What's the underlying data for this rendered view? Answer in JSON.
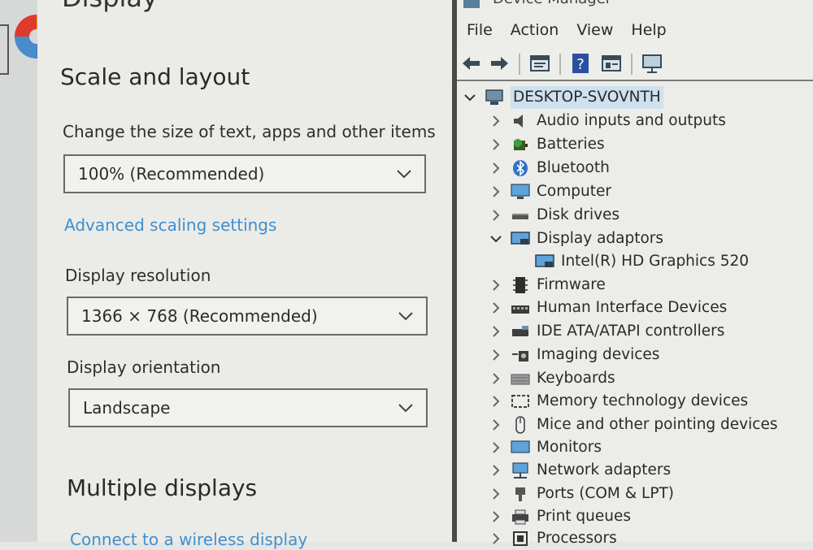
{
  "settings": {
    "page_title": "Display",
    "section_heading": "Scale and layout",
    "scale_label": "Change the size of text, apps and other items",
    "scale_value": "100% (Recommended)",
    "advanced_link": "Advanced scaling settings",
    "resolution_label": "Display resolution",
    "resolution_value": "1366 × 768 (Recommended)",
    "orientation_label": "Display orientation",
    "orientation_value": "Landscape",
    "multiple_heading": "Multiple displays",
    "wireless_link": "Connect to a wireless display"
  },
  "device_manager": {
    "title": "Device Manager",
    "menu": [
      "File",
      "Action",
      "View",
      "Help"
    ],
    "toolbar_icons": [
      "back-arrow-icon",
      "forward-arrow-icon",
      "properties-icon",
      "help-icon",
      "view-resources-icon",
      "monitor-scan-icon"
    ],
    "root": "DESKTOP-SVOVNTH",
    "categories": [
      {
        "label": "Audio inputs and outputs",
        "icon": "speaker-icon",
        "expanded": false
      },
      {
        "label": "Batteries",
        "icon": "battery-icon",
        "expanded": false
      },
      {
        "label": "Bluetooth",
        "icon": "bluetooth-icon",
        "expanded": false
      },
      {
        "label": "Computer",
        "icon": "computer-icon",
        "expanded": false
      },
      {
        "label": "Disk drives",
        "icon": "disk-drive-icon",
        "expanded": false
      },
      {
        "label": "Display adaptors",
        "icon": "display-adapter-icon",
        "expanded": true
      },
      {
        "label": "Intel(R) HD Graphics 520",
        "icon": "display-adapter-icon",
        "child": true
      },
      {
        "label": "Firmware",
        "icon": "firmware-icon",
        "expanded": false
      },
      {
        "label": "Human Interface Devices",
        "icon": "hid-icon",
        "expanded": false
      },
      {
        "label": "IDE ATA/ATAPI controllers",
        "icon": "ide-controller-icon",
        "expanded": false
      },
      {
        "label": "Imaging devices",
        "icon": "camera-icon",
        "expanded": false
      },
      {
        "label": "Keyboards",
        "icon": "keyboard-icon",
        "expanded": false
      },
      {
        "label": "Memory technology devices",
        "icon": "memory-icon",
        "expanded": false
      },
      {
        "label": "Mice and other pointing devices",
        "icon": "mouse-icon",
        "expanded": false
      },
      {
        "label": "Monitors",
        "icon": "monitor-icon",
        "expanded": false
      },
      {
        "label": "Network adapters",
        "icon": "network-icon",
        "expanded": false
      },
      {
        "label": "Ports (COM & LPT)",
        "icon": "port-icon",
        "expanded": false
      },
      {
        "label": "Print queues",
        "icon": "printer-icon",
        "expanded": false
      },
      {
        "label": "Processors",
        "icon": "processor-icon",
        "expanded": false
      }
    ]
  }
}
